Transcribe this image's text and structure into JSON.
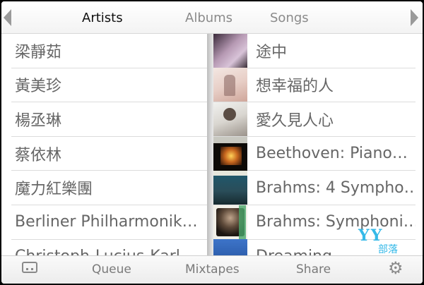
{
  "tabs": {
    "artists": "Artists",
    "albums": "Albums",
    "songs": "Songs",
    "active": "Artists"
  },
  "artists": [
    "梁靜茹",
    "黃美珍",
    "楊丞琳",
    "蔡依林",
    "魔力紅樂團",
    "Berliner Philharmonik…",
    "Christoph-Lucius-Karl…"
  ],
  "albums": [
    "途中",
    "想幸福的人",
    "愛久見人心",
    "Beethoven: Piano…",
    "Brahms: 4 Sympho…",
    "Brahms: Symphoni…",
    "Dreaming"
  ],
  "toolbar": {
    "queue": "Queue",
    "mixtapes": "Mixtapes",
    "share": "Share"
  },
  "watermark": {
    "logo": "YY",
    "caption": "部落"
  },
  "icons": {
    "left_arrow": "left-arrow-icon",
    "right_arrow": "right-arrow-icon",
    "tray": "tray-icon",
    "apple": "apple-logo-icon",
    "gear": "gear-icon"
  }
}
